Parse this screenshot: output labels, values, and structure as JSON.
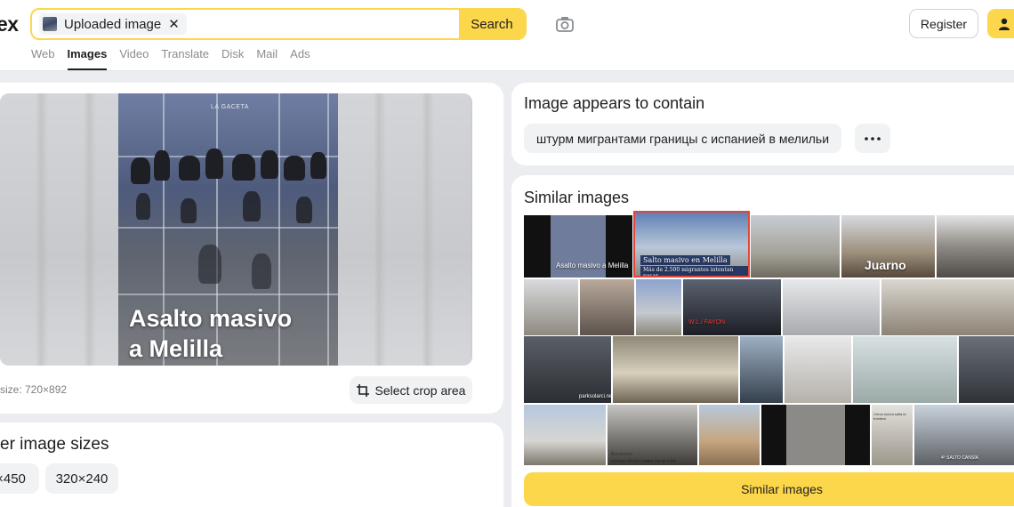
{
  "header": {
    "logo": "ex",
    "search_chip_label": "Uploaded image",
    "search_chip_close": "✕",
    "search_button": "Search",
    "register_button": "Register"
  },
  "tabs": [
    {
      "label": "Web",
      "active": false
    },
    {
      "label": "Images",
      "active": true
    },
    {
      "label": "Video",
      "active": false
    },
    {
      "label": "Translate",
      "active": false
    },
    {
      "label": "Disk",
      "active": false
    },
    {
      "label": "Mail",
      "active": false
    },
    {
      "label": "Ads",
      "active": false
    }
  ],
  "preview": {
    "watermark": "LA GACETA",
    "caption_line1": "Asalto masivo",
    "caption_line2": "a Melilla",
    "size_text": "size: 720×892",
    "crop_button": "Select crop area"
  },
  "sizes": {
    "title": "er image sizes",
    "chips": [
      "×450",
      "320×240"
    ]
  },
  "contains": {
    "title": "Image appears to contain",
    "tag": "штурм мигрантами границы с испанией в мелильи",
    "more_icon": "more-icon"
  },
  "similar": {
    "title": "Similar images",
    "button": "Similar images",
    "tile_texts": {
      "t1": "Asalto masivo a Melilla",
      "t2_line1": "Salto masivo en Melilla",
      "t2_line2": "Más de 2.500 migrantes intentan pasar",
      "t4": "Juarno",
      "t8": "W.L./ FAYON",
      "t12": "parksolarci.net",
      "t20": "מציירים את השואה בעזרת הגבולות",
      "t20b": "ilkvvw.com",
      "t23": "Cerca nueva salta la frontera",
      "t24": "4º SALTO CANSÍA"
    }
  },
  "colors": {
    "accent": "#fcd64b",
    "highlight_border": "#e2463a"
  }
}
